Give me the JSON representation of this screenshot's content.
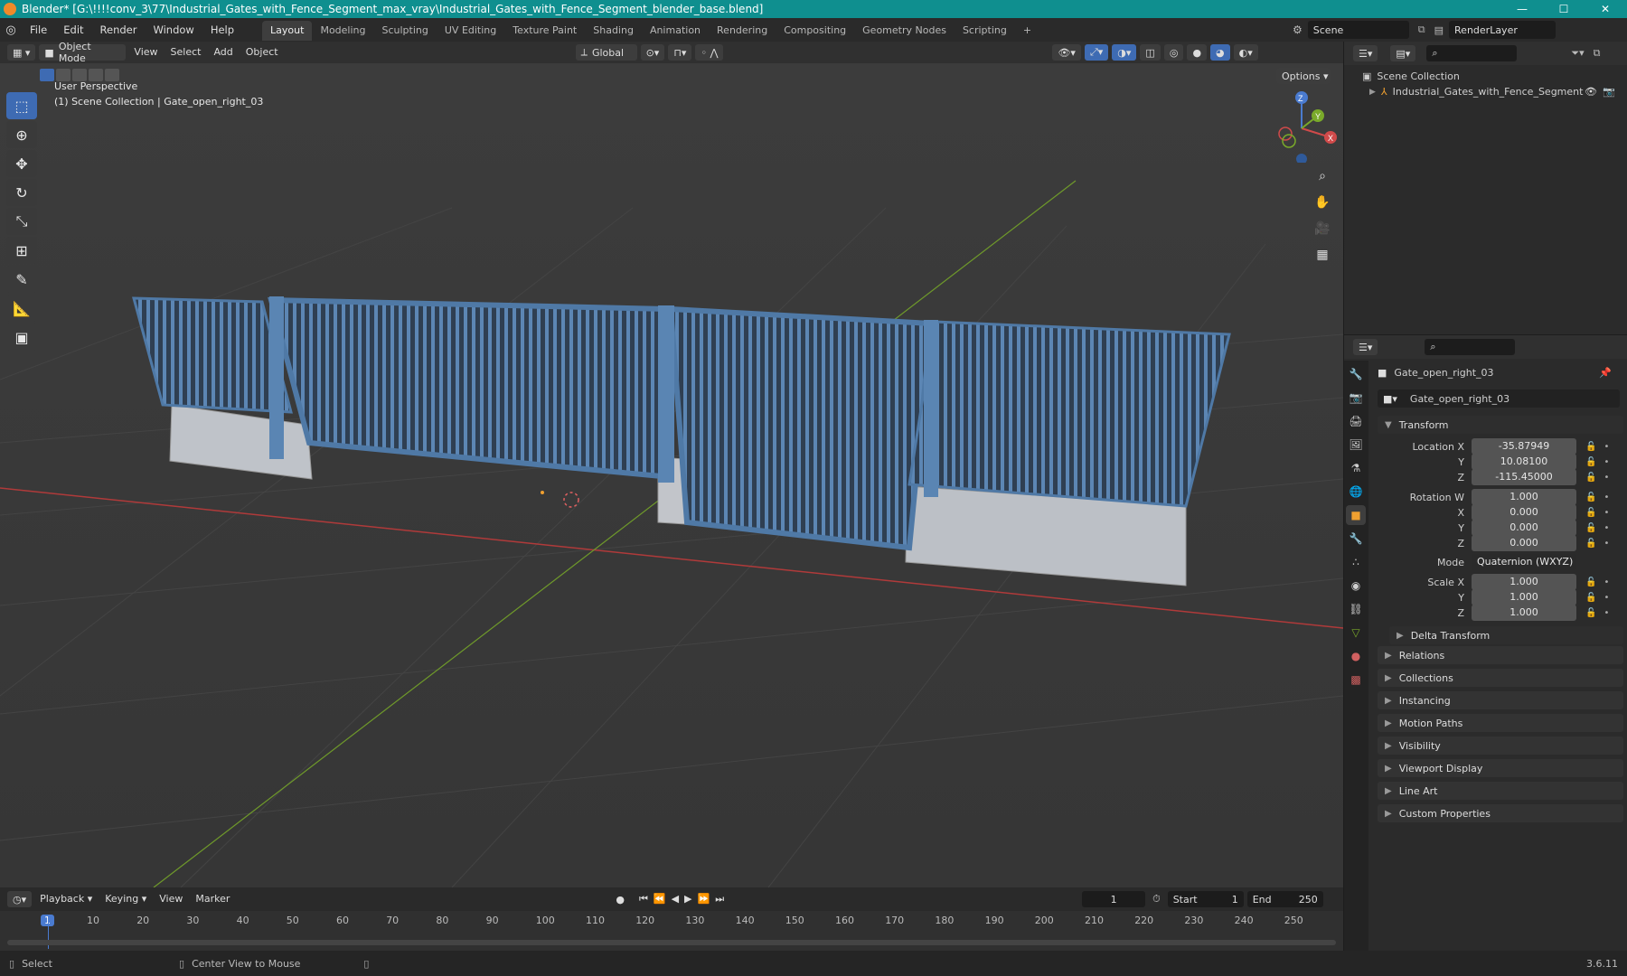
{
  "titlebar": {
    "title": "Blender* [G:\\!!!!conv_3\\77\\Industrial_Gates_with_Fence_Segment_max_vray\\Industrial_Gates_with_Fence_Segment_blender_base.blend]",
    "minimize": "—",
    "maximize": "☐",
    "close": "✕"
  },
  "menus": [
    "File",
    "Edit",
    "Render",
    "Window",
    "Help"
  ],
  "workspaces": [
    "Layout",
    "Modeling",
    "Sculpting",
    "UV Editing",
    "Texture Paint",
    "Shading",
    "Animation",
    "Rendering",
    "Compositing",
    "Geometry Nodes",
    "Scripting"
  ],
  "add_workspace": "+",
  "scene": {
    "label": "Scene",
    "render_layer": "RenderLayer"
  },
  "viewport_header": {
    "mode": "Object Mode",
    "menus": [
      "View",
      "Select",
      "Add",
      "Object"
    ],
    "orientation": "Global",
    "options": "Options"
  },
  "viewport": {
    "perspective": "User Perspective",
    "collection_info": "(1) Scene Collection | Gate_open_right_03"
  },
  "gizmo": {
    "x": "X",
    "y": "Y",
    "z": "Z"
  },
  "outliner": {
    "root": "Scene Collection",
    "item": "Industrial_Gates_with_Fence_Segment"
  },
  "properties": {
    "object_name": "Gate_open_right_03",
    "data_name": "Gate_open_right_03",
    "transform_label": "Transform",
    "location": {
      "label": "Location X",
      "x": "-35.87949",
      "y": "10.08100",
      "z": "-115.45000"
    },
    "rotation": {
      "label": "Rotation W",
      "w": "1.000",
      "x": "0.000",
      "y": "0.000",
      "z": "0.000"
    },
    "mode": {
      "label": "Mode",
      "value": "Quaternion (WXYZ)"
    },
    "scale": {
      "label": "Scale X",
      "x": "1.000",
      "y": "1.000",
      "z": "1.000"
    },
    "axis_labels": {
      "x": "X",
      "y": "Y",
      "z": "Z"
    },
    "delta_transform": "Delta Transform",
    "panels": [
      "Relations",
      "Collections",
      "Instancing",
      "Motion Paths",
      "Visibility",
      "Viewport Display",
      "Line Art",
      "Custom Properties"
    ]
  },
  "timeline": {
    "menus": [
      "Playback",
      "Keying",
      "View",
      "Marker"
    ],
    "current_frame": "1",
    "start_label": "Start",
    "start": "1",
    "end_label": "End",
    "end": "250",
    "ticks": [
      "1",
      "10",
      "20",
      "30",
      "40",
      "50",
      "60",
      "70",
      "80",
      "90",
      "100",
      "110",
      "120",
      "130",
      "140",
      "150",
      "160",
      "170",
      "180",
      "190",
      "200",
      "210",
      "220",
      "230",
      "240",
      "250"
    ]
  },
  "status": {
    "left": "Select",
    "middle": "Center View to Mouse",
    "version": "3.6.11"
  }
}
